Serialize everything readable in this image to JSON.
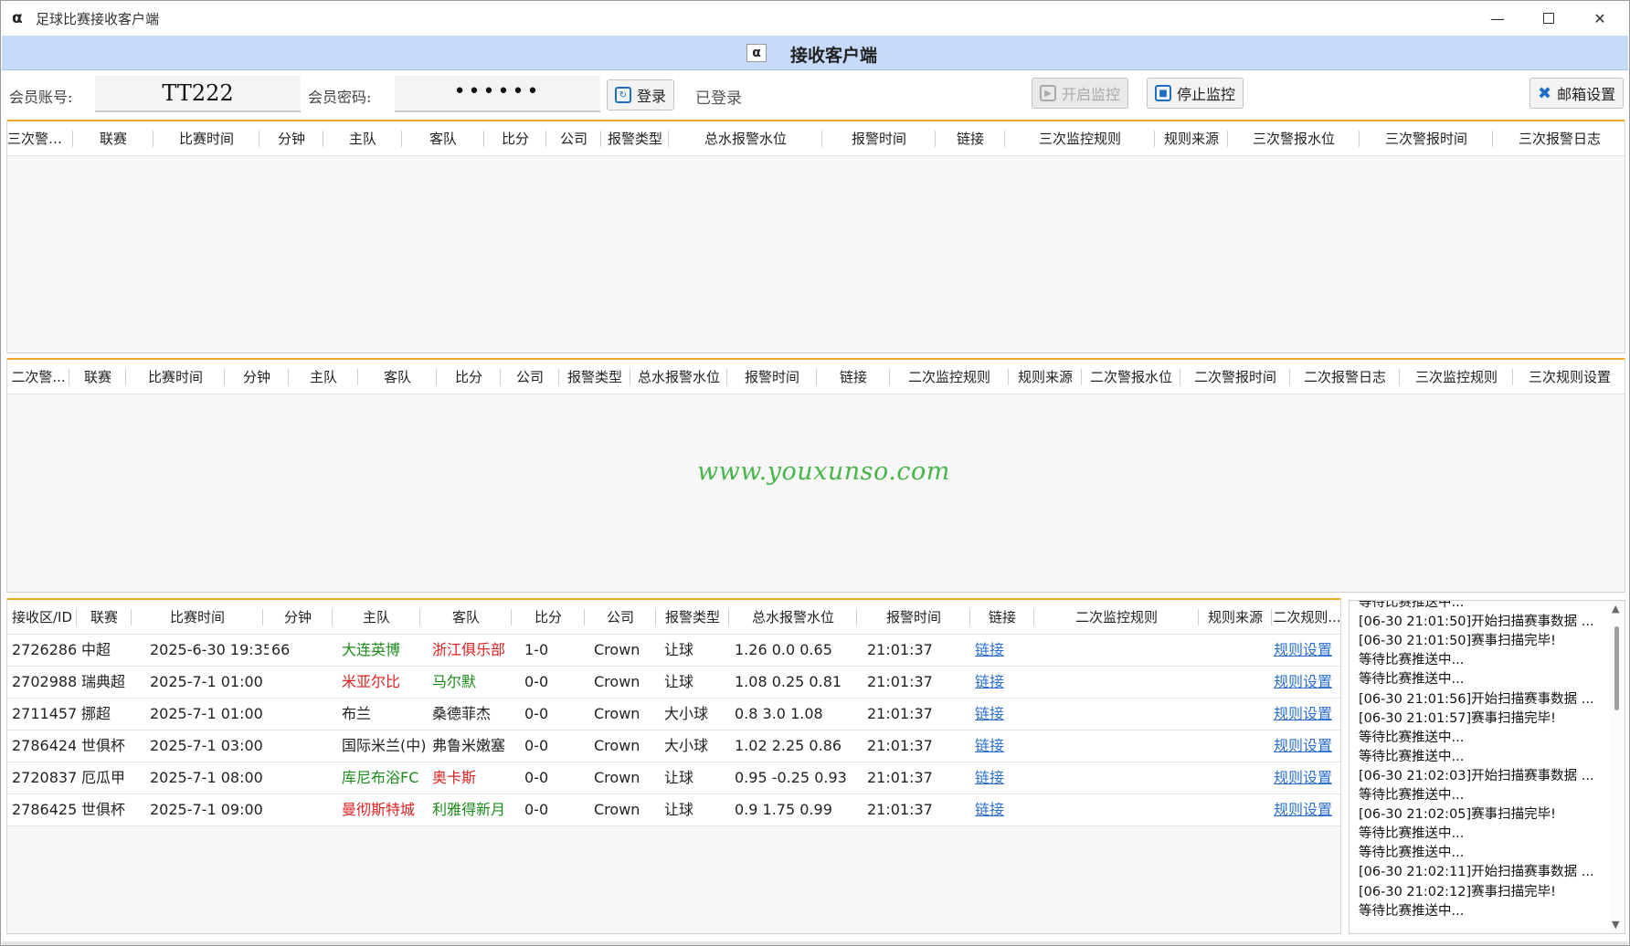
{
  "window": {
    "title": "足球比赛接收客户端",
    "app_icon": "α"
  },
  "header": {
    "title": "接收客户端",
    "icon": "α"
  },
  "login": {
    "account_label": "会员账号:",
    "account_value": "TT222",
    "password_label": "会员密码:",
    "password_value": "••••••",
    "login_button": "登录",
    "status": "已登录",
    "start_monitor": "开启监控",
    "stop_monitor": "停止监控",
    "email_settings": "邮箱设置"
  },
  "panel1": {
    "columns": [
      "三次警报...",
      "联赛",
      "比赛时间",
      "分钟",
      "主队",
      "客队",
      "比分",
      "公司",
      "报警类型",
      "总水报警水位",
      "报警时间",
      "链接",
      "三次监控规则",
      "规则来源",
      "三次警报水位",
      "三次警报时间",
      "三次报警日志"
    ]
  },
  "panel2": {
    "columns": [
      "二次警...",
      "联赛",
      "比赛时间",
      "分钟",
      "主队",
      "客队",
      "比分",
      "公司",
      "报警类型",
      "总水报警水位",
      "报警时间",
      "链接",
      "二次监控规则",
      "规则来源",
      "二次警报水位",
      "二次警报时间",
      "二次报警日志",
      "三次监控规则",
      "三次规则设置"
    ],
    "watermark": "www.youxunso.com"
  },
  "panel3": {
    "columns": [
      "接收区/ID",
      "联赛",
      "比赛时间",
      "分钟",
      "主队",
      "客队",
      "比分",
      "公司",
      "报警类型",
      "总水报警水位",
      "报警时间",
      "链接",
      "二次监控规则",
      "规则来源",
      "二次规则..."
    ],
    "rows": [
      {
        "id": "2726286",
        "league": "中超",
        "time": "2025-6-30 19:35",
        "minute": "66",
        "home": "大连英博",
        "home_color": "green",
        "away": "浙江俱乐部",
        "away_color": "red",
        "score": "1-0",
        "company": "Crown",
        "type": "让球",
        "level": "1.26 0.0 0.65",
        "alarm_time": "21:01:37",
        "link": "链接",
        "rule": "规则设置"
      },
      {
        "id": "2702988",
        "league": "瑞典超",
        "time": "2025-7-1 01:00",
        "minute": "",
        "home": "米亚尔比",
        "home_color": "red",
        "away": "马尔默",
        "away_color": "green",
        "score": "0-0",
        "company": "Crown",
        "type": "让球",
        "level": "1.08 0.25 0.81",
        "alarm_time": "21:01:37",
        "link": "链接",
        "rule": "规则设置"
      },
      {
        "id": "2711457",
        "league": "挪超",
        "time": "2025-7-1 01:00",
        "minute": "",
        "home": "布兰",
        "home_color": "dark",
        "away": "桑德菲杰",
        "away_color": "dark",
        "score": "0-0",
        "company": "Crown",
        "type": "大小球",
        "level": "0.8 3.0 1.08",
        "alarm_time": "21:01:37",
        "link": "链接",
        "rule": "规则设置"
      },
      {
        "id": "2786424",
        "league": "世俱杯",
        "time": "2025-7-1 03:00",
        "minute": "",
        "home": "国际米兰(中)",
        "home_color": "dark",
        "away": "弗鲁米嫩塞",
        "away_color": "dark",
        "score": "0-0",
        "company": "Crown",
        "type": "大小球",
        "level": "1.02 2.25 0.86",
        "alarm_time": "21:01:37",
        "link": "链接",
        "rule": "规则设置"
      },
      {
        "id": "2720837",
        "league": "厄瓜甲",
        "time": "2025-7-1 08:00",
        "minute": "",
        "home": "库尼布浴FC",
        "home_color": "green",
        "away": "奥卡斯",
        "away_color": "red",
        "score": "0-0",
        "company": "Crown",
        "type": "让球",
        "level": "0.95 -0.25 0.93",
        "alarm_time": "21:01:37",
        "link": "链接",
        "rule": "规则设置"
      },
      {
        "id": "2786425",
        "league": "世俱杯",
        "time": "2025-7-1 09:00",
        "minute": "",
        "home": "曼彻斯特城",
        "home_color": "red",
        "away": "利雅得新月",
        "away_color": "green",
        "score": "0-0",
        "company": "Crown",
        "type": "让球",
        "level": "0.9 1.75 0.99",
        "alarm_time": "21:01:37",
        "link": "链接",
        "rule": "规则设置"
      }
    ]
  },
  "log": {
    "lines": [
      "等待比赛推送中...",
      "[06-30 21:01:50]开始扫描赛事数据 ...",
      "[06-30 21:01:50]赛事扫描完毕!",
      "等待比赛推送中...",
      "等待比赛推送中...",
      "[06-30 21:01:56]开始扫描赛事数据 ...",
      "[06-30 21:01:57]赛事扫描完毕!",
      "等待比赛推送中...",
      "等待比赛推送中...",
      "[06-30 21:02:03]开始扫描赛事数据 ...",
      "等待比赛推送中...",
      "[06-30 21:02:05]赛事扫描完毕!",
      "等待比赛推送中...",
      "等待比赛推送中...",
      "[06-30 21:02:11]开始扫描赛事数据 ...",
      "[06-30 21:02:12]赛事扫描完毕!",
      "等待比赛推送中..."
    ]
  }
}
